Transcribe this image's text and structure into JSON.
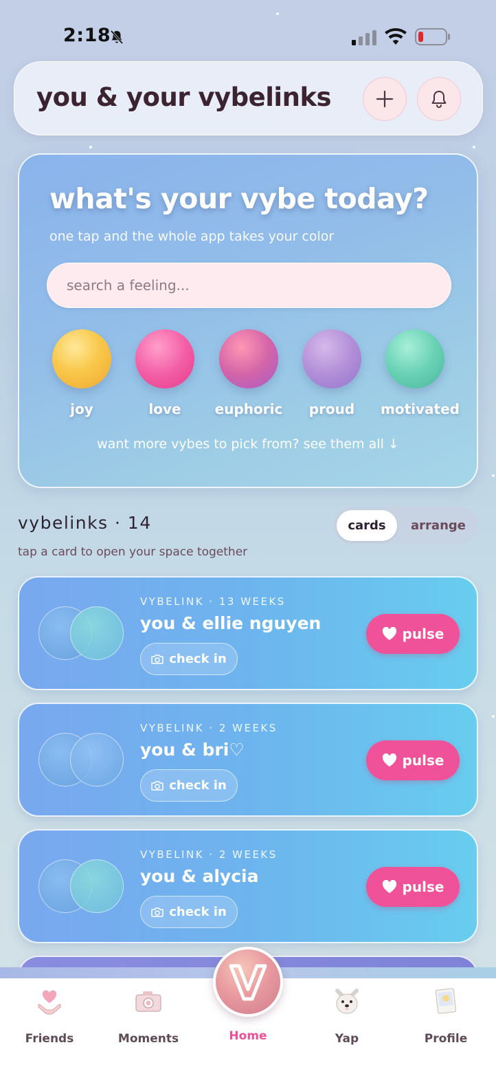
{
  "status_bar": {
    "time": "2:18"
  },
  "header": {
    "title": "you & your vybelinks"
  },
  "vybe_picker": {
    "title": "what's your vybe today?",
    "subtitle": "one tap and the whole app takes your color",
    "search_placeholder": "search a feeling...",
    "moods": [
      {
        "label": "joy"
      },
      {
        "label": "love"
      },
      {
        "label": "euphoric"
      },
      {
        "label": "proud"
      },
      {
        "label": "motivated"
      }
    ],
    "see_all": "want more vybes to pick from? see them all ↓"
  },
  "vybelinks": {
    "title": "vybelinks · 14",
    "subtitle": "tap a card to open your space together",
    "view_toggle": {
      "cards": "cards",
      "arrange": "arrange",
      "selected": "cards"
    },
    "items": [
      {
        "meta": "VYBELINK · 13 WEEKS",
        "name": "you & ellie nguyen",
        "check_in": "check in",
        "pulse": "pulse"
      },
      {
        "meta": "VYBELINK · 2 WEEKS",
        "name": "you & bri♡",
        "check_in": "check in",
        "pulse": "pulse"
      },
      {
        "meta": "VYBELINK · 2 WEEKS",
        "name": "you & alycia",
        "check_in": "check in",
        "pulse": "pulse"
      }
    ]
  },
  "tab_bar": {
    "tabs": [
      {
        "label": "Friends",
        "icon": "heart-hands-icon"
      },
      {
        "label": "Moments",
        "icon": "camera-icon"
      },
      {
        "label": "Home",
        "icon": "v-logo-icon",
        "active": true
      },
      {
        "label": "Yap",
        "icon": "dog-icon"
      },
      {
        "label": "Profile",
        "icon": "polaroid-icon"
      }
    ]
  },
  "colors": {
    "accent_pink": "#f0529a",
    "title_dark": "#3b2330",
    "card_blue": "#6db4ee"
  }
}
